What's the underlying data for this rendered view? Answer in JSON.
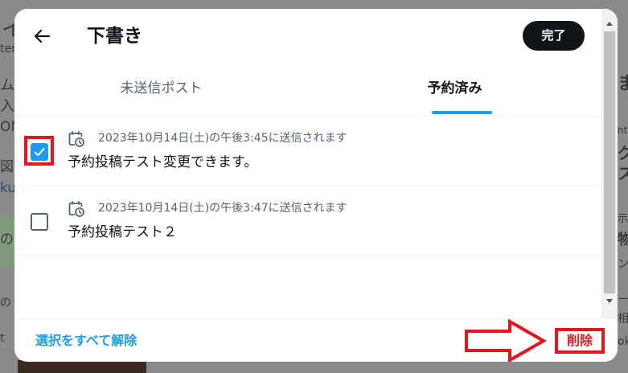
{
  "background_fragments": {
    "frag_1": "イ",
    "frag_2": "ter",
    "frag_3": "ム",
    "frag_4": "入",
    "frag_5": "OM",
    "frag_6": "図",
    "frag_7": "ku",
    "frag_8": "のコ",
    "frag_9": "の",
    "frag_10": "t",
    "frag_r1": "ま",
    "frag_r2": "nt",
    "frag_r3": "グ",
    "frag_r4": "ス",
    "frag_r5": "示",
    "frag_r6": "物",
    "frag_r7": "ン",
    "frag_r8": "ー",
    "frag_r9": "相",
    "frag_r10": "ok"
  },
  "header": {
    "title": "下書き",
    "done_label": "完了"
  },
  "tabs": [
    {
      "label": "未送信ポスト",
      "active": false
    },
    {
      "label": "予約済み",
      "active": true
    }
  ],
  "drafts": [
    {
      "schedule": "2023年10月14日(土)の午後3:45に送信されます",
      "text": "予約投稿テスト変更できます。",
      "checked": true
    },
    {
      "schedule": "2023年10月14日(土)の午後3:47に送信されます",
      "text": "予約投稿テスト２",
      "checked": false
    }
  ],
  "footer": {
    "clear_all_label": "選択をすべて解除",
    "delete_label": "削除"
  },
  "colors": {
    "accent": "#1d9bf0",
    "highlight": "#e8141c",
    "text_primary": "#0f1419",
    "text_secondary": "#536471"
  },
  "icons": {
    "back": "arrow-left-icon",
    "schedule": "calendar-clock-icon",
    "check": "checkmark-icon",
    "annotation_arrow": "right-arrow-icon"
  }
}
